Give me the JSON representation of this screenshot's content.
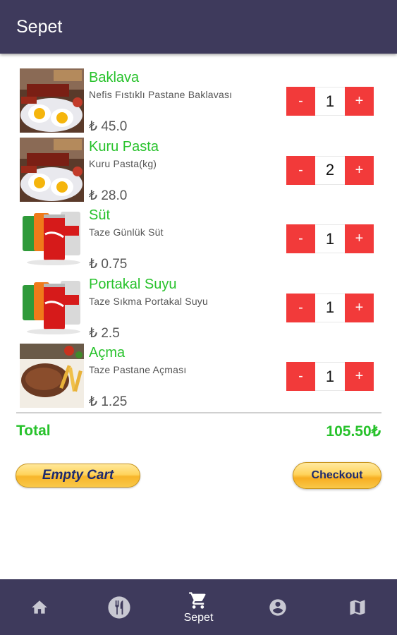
{
  "header": {
    "title": "Sepet"
  },
  "colors": {
    "header_bg": "#3e3a5c",
    "accent_green": "#27c22b",
    "qty_red": "#f23a3a",
    "button_gold": "#f7b52a"
  },
  "cart": {
    "items": [
      {
        "name": "Baklava",
        "description": "Nefis Fıstıklı Pastane Baklavası",
        "price": "₺ 45.0",
        "quantity": "1",
        "image": "breakfast-plate"
      },
      {
        "name": "Kuru Pasta",
        "description": "Kuru Pasta(kg)",
        "price": "₺ 28.0",
        "quantity": "2",
        "image": "breakfast-plate"
      },
      {
        "name": "Süt",
        "description": "Taze Günlük Süt",
        "price": "₺ 0.75",
        "quantity": "1",
        "image": "soda-cans"
      },
      {
        "name": "Portakal Suyu",
        "description": "Taze Sıkma Portakal Suyu",
        "price": "₺ 2.5",
        "quantity": "1",
        "image": "soda-cans"
      },
      {
        "name": "Açma",
        "description": "Taze Pastane Açması",
        "price": "₺ 1.25",
        "quantity": "1",
        "image": "steak-fries"
      }
    ],
    "minus_label": "-",
    "plus_label": "+"
  },
  "summary": {
    "total_label": "Total",
    "total_value": "105.50₺"
  },
  "actions": {
    "empty_cart_label": "Empty Cart",
    "checkout_label": "Checkout"
  },
  "bottom_nav": {
    "items": [
      {
        "icon": "home-icon",
        "label": ""
      },
      {
        "icon": "restaurant-icon",
        "label": ""
      },
      {
        "icon": "cart-icon",
        "label": "Sepet"
      },
      {
        "icon": "account-icon",
        "label": ""
      },
      {
        "icon": "map-icon",
        "label": ""
      }
    ]
  }
}
